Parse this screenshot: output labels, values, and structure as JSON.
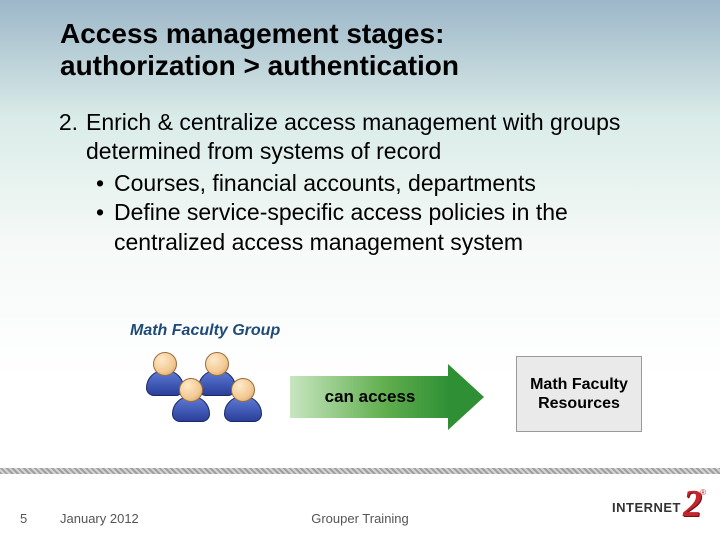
{
  "title_line1": "Access management stages:",
  "title_line2": "authorization > authentication",
  "list": {
    "number": "2.",
    "text": "Enrich & centralize access management with groups determined from systems of record",
    "sub": [
      "Courses, financial accounts, departments",
      "Define service-specific access policies in the centralized access management system"
    ]
  },
  "group_label": "Math Faculty Group",
  "arrow_label": "can access",
  "resource_box": "Math Faculty Resources",
  "footer": {
    "slide_number": "5",
    "date": "January 2012",
    "center": "Grouper Training"
  },
  "logo": {
    "word": "INTERNET",
    "digit": "2",
    "reg": "®"
  }
}
